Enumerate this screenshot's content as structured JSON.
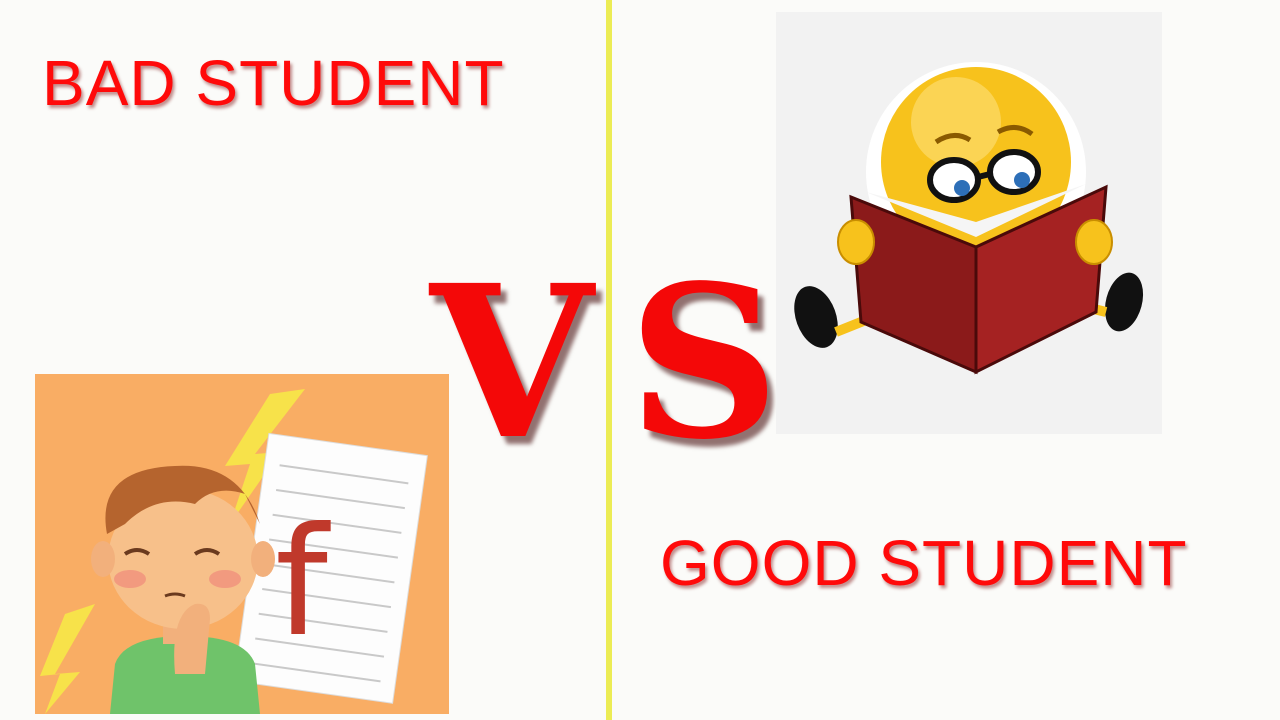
{
  "left": {
    "title": "BAD STUDENT",
    "grade_letter": "f"
  },
  "right": {
    "title": "GOOD STUDENT"
  },
  "versus": {
    "v": "V",
    "s": "S"
  },
  "colors": {
    "title_red": "#ff0a0a",
    "vs_red": "#f40808",
    "divider_yellow": "#ecec55",
    "bad_panel_bg": "#f9ad64",
    "book_red": "#8b1a1a",
    "emoji_yellow": "#f7c21c"
  }
}
